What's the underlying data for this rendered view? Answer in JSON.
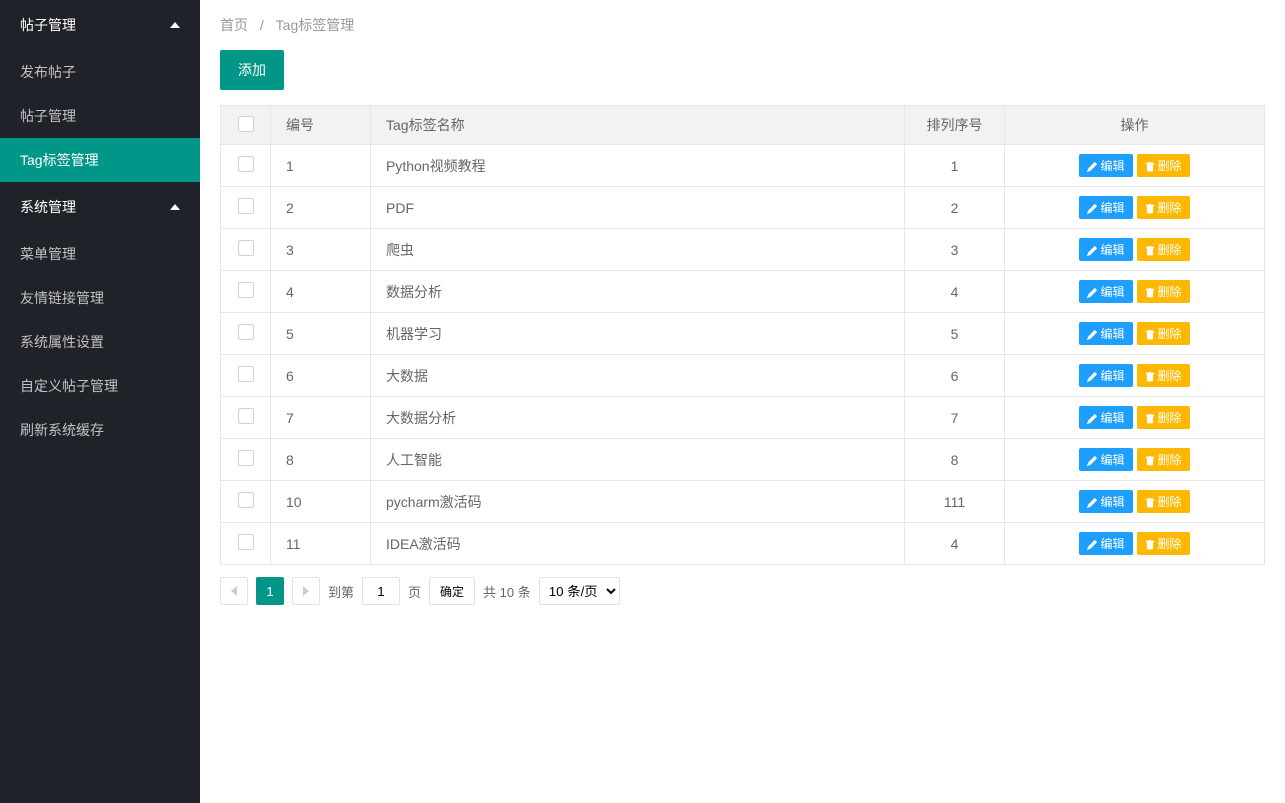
{
  "sidebar": {
    "groups": [
      {
        "title": "帖子管理",
        "items": [
          {
            "label": "发布帖子",
            "active": false
          },
          {
            "label": "帖子管理",
            "active": false
          },
          {
            "label": "Tag标签管理",
            "active": true
          }
        ]
      },
      {
        "title": "系统管理",
        "items": [
          {
            "label": "菜单管理",
            "active": false
          },
          {
            "label": "友情链接管理",
            "active": false
          },
          {
            "label": "系统属性设置",
            "active": false
          },
          {
            "label": "自定义帖子管理",
            "active": false
          },
          {
            "label": "刷新系统缓存",
            "active": false
          }
        ]
      }
    ]
  },
  "breadcrumb": {
    "home": "首页",
    "current": "Tag标签管理"
  },
  "actions": {
    "add": "添加",
    "edit": "编辑",
    "delete": "删除"
  },
  "table": {
    "headers": {
      "id": "编号",
      "name": "Tag标签名称",
      "sort": "排列序号",
      "action": "操作"
    },
    "rows": [
      {
        "id": "1",
        "name": "Python视频教程",
        "sort": "1"
      },
      {
        "id": "2",
        "name": "PDF",
        "sort": "2"
      },
      {
        "id": "3",
        "name": "爬虫",
        "sort": "3"
      },
      {
        "id": "4",
        "name": "数据分析",
        "sort": "4"
      },
      {
        "id": "5",
        "name": "机器学习",
        "sort": "5"
      },
      {
        "id": "6",
        "name": "大数据",
        "sort": "6"
      },
      {
        "id": "7",
        "name": "大数据分析",
        "sort": "7"
      },
      {
        "id": "8",
        "name": "人工智能",
        "sort": "8"
      },
      {
        "id": "10",
        "name": "pycharm激活码",
        "sort": "111"
      },
      {
        "id": "11",
        "name": "IDEA激活码",
        "sort": "4"
      }
    ]
  },
  "pager": {
    "current_page": "1",
    "goto_label": "到第",
    "page_input": "1",
    "page_suffix": "页",
    "confirm": "确定",
    "total": "共 10 条",
    "per_page": "10 条/页"
  }
}
